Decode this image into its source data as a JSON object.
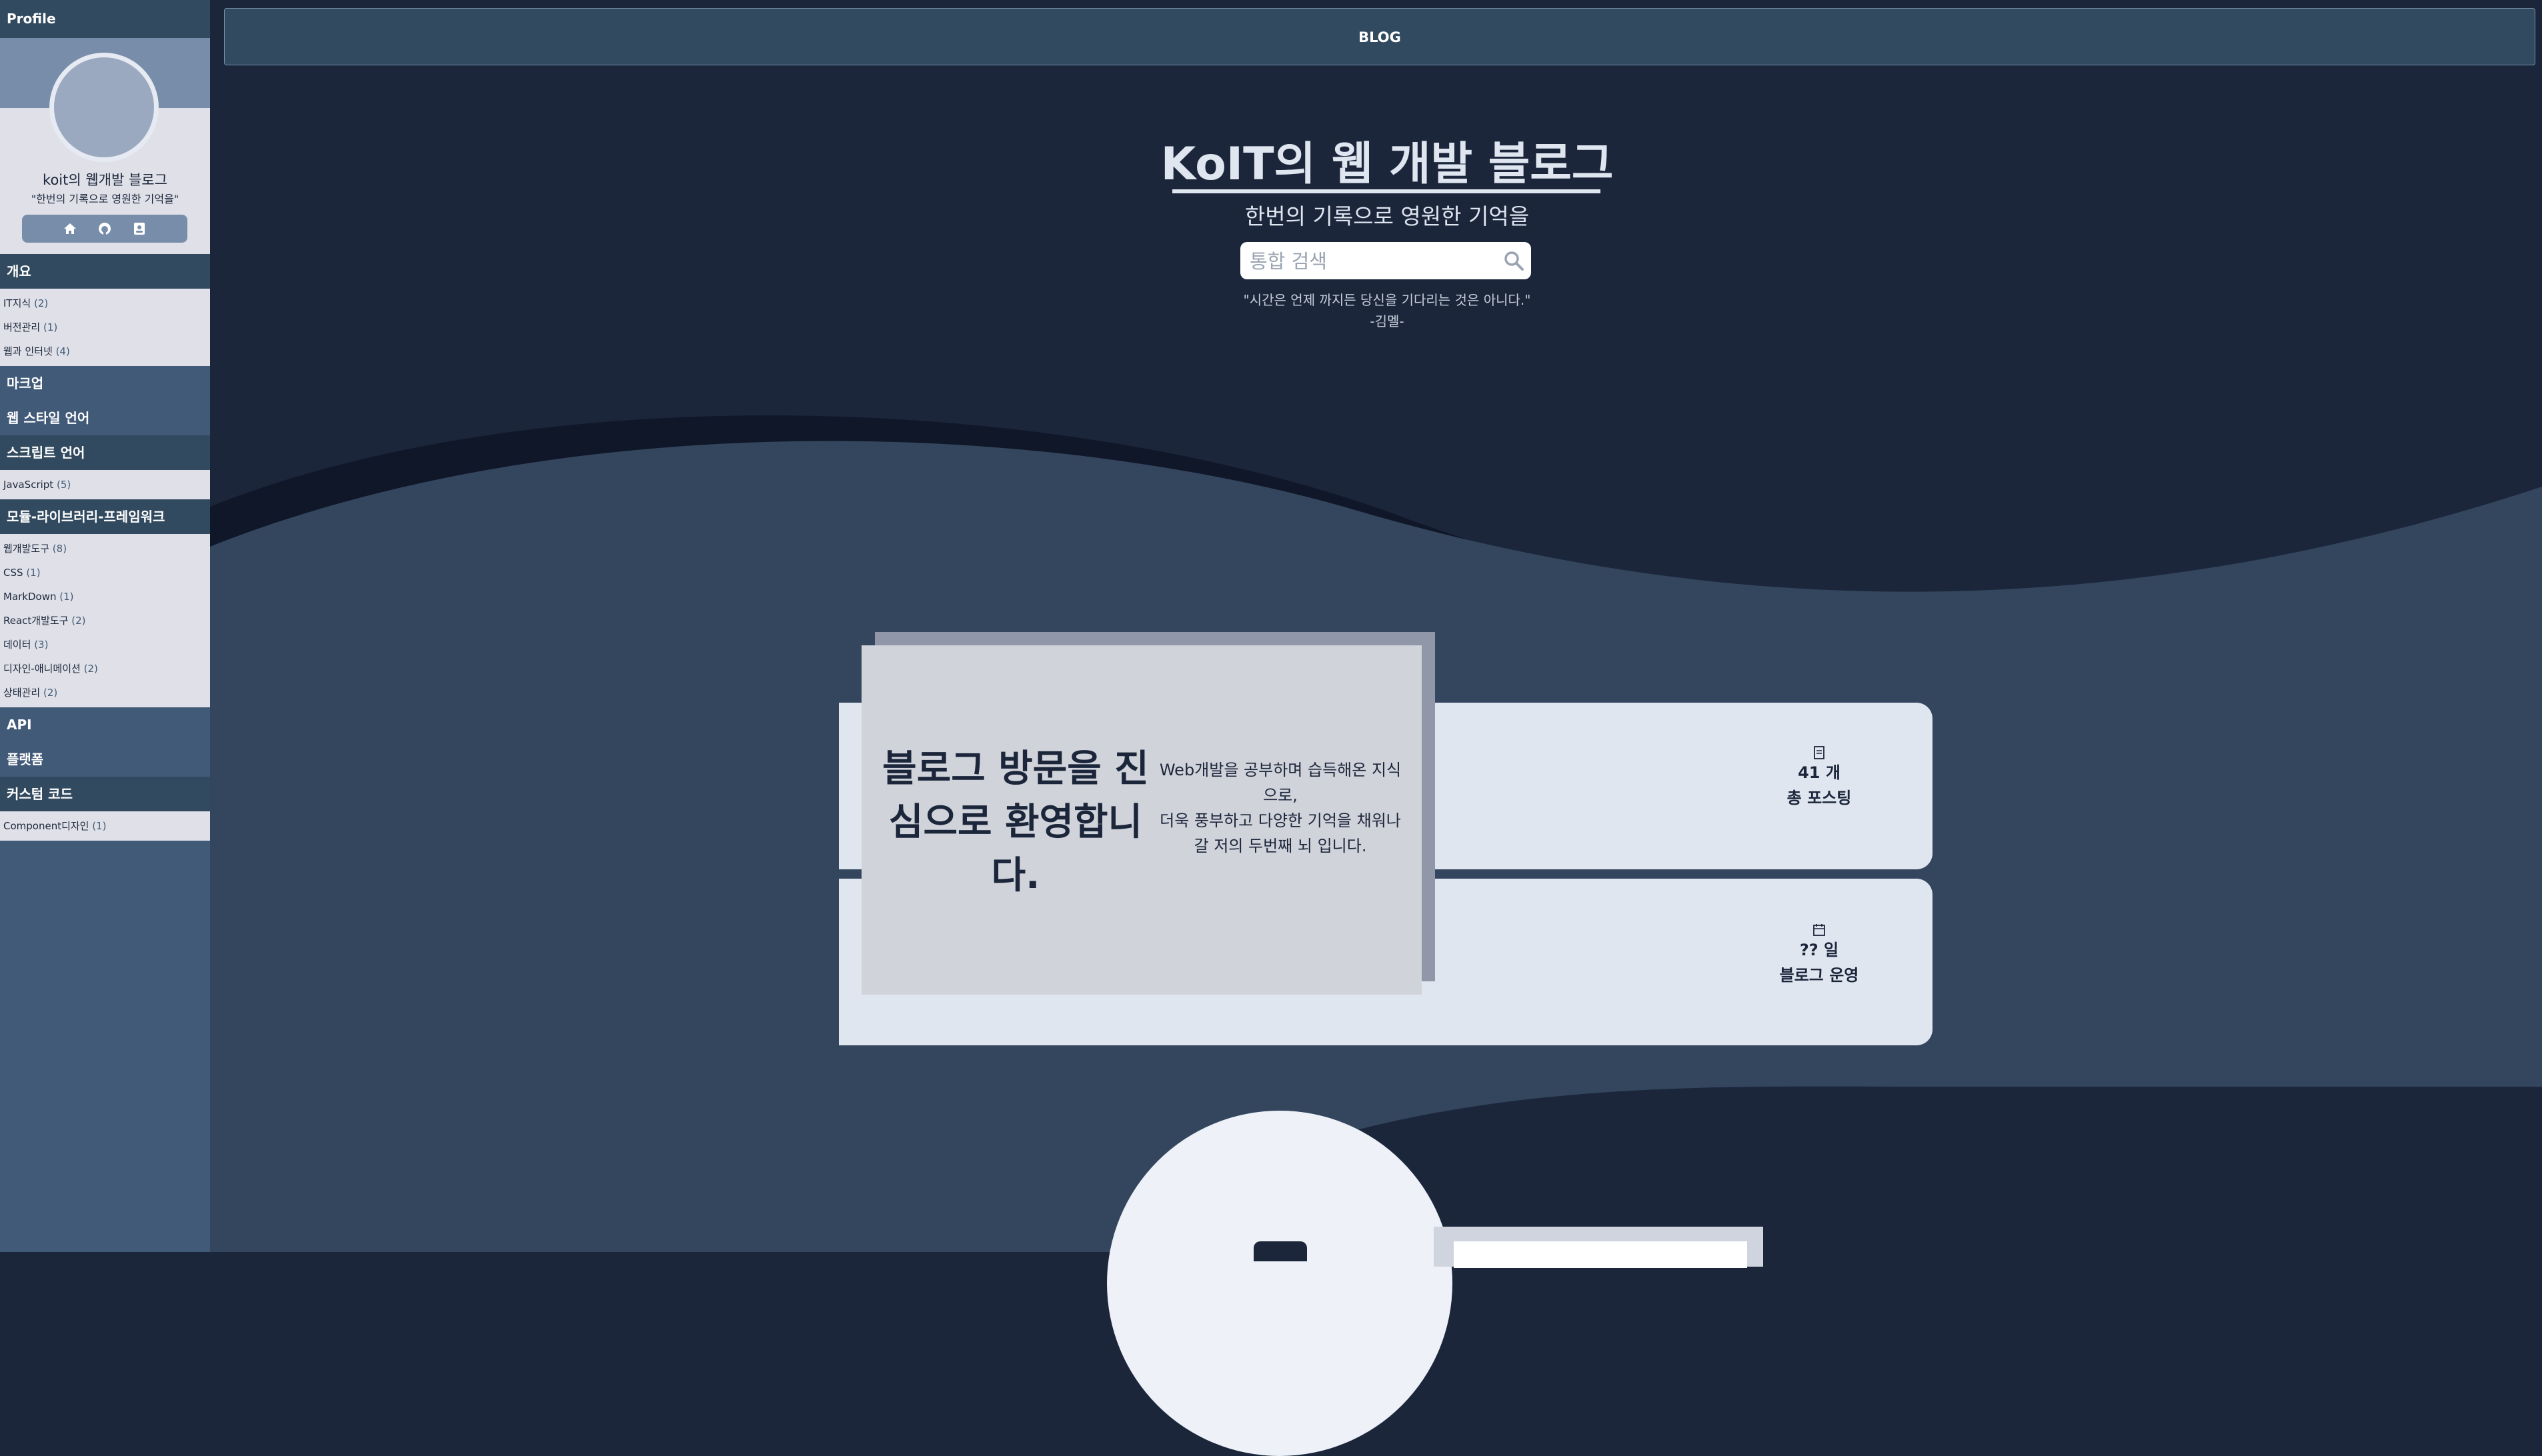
{
  "sidebar": {
    "header": "Profile",
    "profile": {
      "name": "koit의 웹개발 블로그",
      "motto": "\"한번의 기록으로 영원한 기억을\"",
      "links": [
        "home-icon",
        "github-icon",
        "contact-icon"
      ]
    },
    "categories": [
      {
        "label": "개요",
        "items": [
          {
            "name": "IT지식",
            "count": "(2)"
          },
          {
            "name": "버전관리",
            "count": "(1)"
          },
          {
            "name": "웹과 인터넷",
            "count": "(4)"
          }
        ]
      },
      {
        "label": "마크업",
        "items": []
      },
      {
        "label": "웹 스타일 언어",
        "items": []
      },
      {
        "label": "스크립트 언어",
        "items": [
          {
            "name": "JavaScript",
            "count": "(5)"
          }
        ]
      },
      {
        "label": "모듈-라이브러리-프레임워크",
        "items": [
          {
            "name": "웹개발도구",
            "count": "(8)"
          },
          {
            "name": "CSS",
            "count": "(1)"
          },
          {
            "name": "MarkDown",
            "count": "(1)"
          },
          {
            "name": "React개발도구",
            "count": "(2)"
          },
          {
            "name": "데이터",
            "count": "(3)"
          },
          {
            "name": "디자인-애니메이션",
            "count": "(2)"
          },
          {
            "name": "상태관리",
            "count": "(2)"
          }
        ]
      },
      {
        "label": "API",
        "items": []
      },
      {
        "label": "플랫폼",
        "items": []
      },
      {
        "label": "커스텀 코드",
        "items": [
          {
            "name": "Component디자인",
            "count": "(1)"
          }
        ]
      }
    ]
  },
  "topbar": {
    "label": "BLOG"
  },
  "hero": {
    "title": "KoIT의 웹 개발 블로그",
    "subtitle": "한번의 기록으로 영원한 기억을",
    "search_placeholder": "통합 검색",
    "quote": "\"시간은 언제 까지든 당신을 기다리는 것은 아니다.\"",
    "quote_author": "-김멜-"
  },
  "welcome": {
    "title": "블로그 방문을 진심으로 환영합니다.",
    "description_lines": [
      "Web개발을 공부하며 습득해온 지식으로,",
      "더욱 풍부하고 다양한 기억을 채워나갈 저의 두번째 뇌 입니다."
    ]
  },
  "stats": [
    {
      "icon": "document-icon",
      "value": "41 개",
      "label": "총 포스팅"
    },
    {
      "icon": "calendar-icon",
      "value": "?? 일",
      "label": "블로그 운영"
    }
  ],
  "colors": {
    "navy": "#1b263b",
    "slate": "#415a77",
    "steel": "#778da9",
    "light": "#e0e1e8"
  }
}
